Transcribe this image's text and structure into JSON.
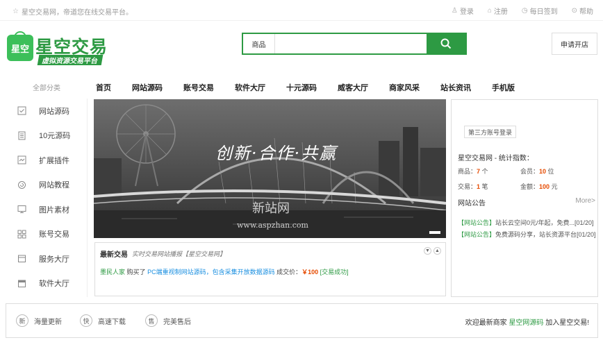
{
  "topbar": {
    "welcome": "星空交易网，帝道您在线交易平台。",
    "links": [
      "登录",
      "注册",
      "每日签到",
      "帮助"
    ]
  },
  "logo": {
    "badge": "星空",
    "title": "星空交易",
    "subtitle": "虚拟资源交易平台"
  },
  "search": {
    "category": "商品",
    "placeholder": ""
  },
  "apply_button": "申请开店",
  "nav": {
    "all_categories": "全部分类",
    "items": [
      "首页",
      "网站源码",
      "账号交易",
      "软件大厅",
      "十元源码",
      "威客大厅",
      "商家风采",
      "站长资讯",
      "手机版"
    ]
  },
  "sidebar": {
    "items": [
      "网站源码",
      "10元源码",
      "扩展插件",
      "网站教程",
      "图片素材",
      "账号交易",
      "服务大厅",
      "软件大厅"
    ]
  },
  "banner": {
    "slogan": "创新·合作·共赢",
    "watermark_cn": "新站网",
    "watermark_url": "www.aspzhan.com"
  },
  "trades": {
    "title": "最新交易",
    "subtitle": "实时交易网站播报【星空交易网】",
    "row": {
      "buyer": "墨民人家",
      "action": "购买了",
      "product": "PC端重视制网站源码，包含采集开放数据源码",
      "price_label": "成交价：",
      "price": "￥100",
      "status": "[交易成功]"
    }
  },
  "right_panel": {
    "third_party_login": "第三方账号登录",
    "stats_title": "星空交易网 - 统计指数：",
    "stats": [
      {
        "label": "商品：",
        "value": "7",
        "unit": "个"
      },
      {
        "label": "会员：",
        "value": "10",
        "unit": "位"
      },
      {
        "label": "交易：",
        "value": "1",
        "unit": "笔"
      },
      {
        "label": "金额：",
        "value": "100",
        "unit": "元"
      }
    ],
    "notice_title": "网站公告",
    "more": "More>",
    "notices": [
      {
        "tag": "【网站公告】",
        "text": "站长云空间0元/年起，免费...",
        "date": "[01/20]"
      },
      {
        "tag": "【网站公告】",
        "text": "免费源码分享，站长资源平台",
        "date": "[01/20]"
      }
    ]
  },
  "bottom": {
    "features": [
      {
        "badge": "新",
        "label": "海量更新"
      },
      {
        "badge": "快",
        "label": "高速下载"
      },
      {
        "badge": "售",
        "label": "完美售后"
      }
    ],
    "welcome_prefix": "欢迎最新商家",
    "welcome_shop": "星空网源码",
    "welcome_suffix": "加入星空交易!"
  },
  "colors": {
    "brand": "#2d9a43",
    "accent": "#e64a00"
  }
}
